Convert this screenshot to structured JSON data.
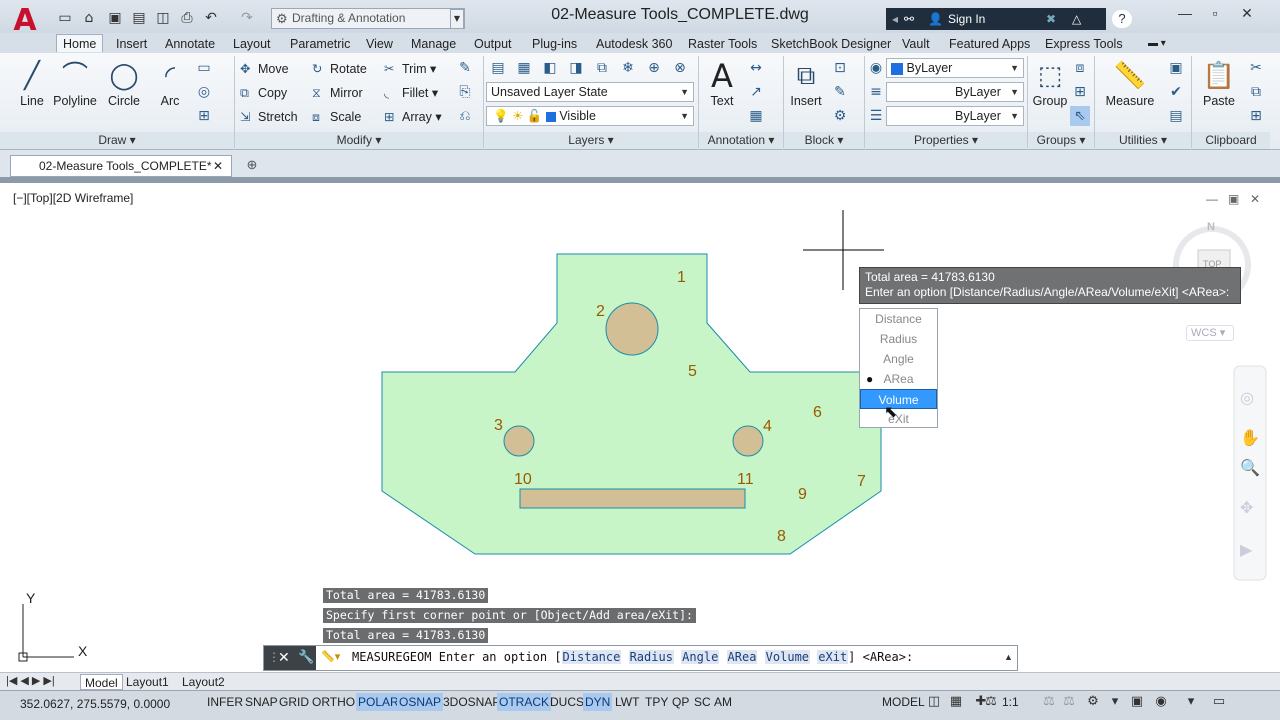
{
  "window": {
    "title": "02-Measure Tools_COMPLETE.dwg",
    "workspace": "Drafting & Annotation",
    "sign_in": "Sign In"
  },
  "ribbon_tabs": [
    "Home",
    "Insert",
    "Annotate",
    "Layout",
    "Parametric",
    "View",
    "Manage",
    "Output",
    "Plug-ins",
    "Autodesk 360",
    "Raster Tools",
    "SketchBook Designer",
    "Vault",
    "Featured Apps",
    "Express Tools"
  ],
  "draw": {
    "title": "Draw",
    "line": "Line",
    "polyline": "Polyline",
    "circle": "Circle",
    "arc": "Arc"
  },
  "modify": {
    "title": "Modify",
    "move": "Move",
    "rotate": "Rotate",
    "trim": "Trim",
    "copy": "Copy",
    "mirror": "Mirror",
    "fillet": "Fillet",
    "stretch": "Stretch",
    "scale": "Scale",
    "array": "Array"
  },
  "layers": {
    "title": "Layers",
    "layer_state": "Unsaved Layer State",
    "layer_vis": "Visible"
  },
  "annotation": {
    "title": "Annotation",
    "text": "Text"
  },
  "block": {
    "title": "Block",
    "insert": "Insert"
  },
  "properties": {
    "title": "Properties",
    "color": "ByLayer",
    "linetype": "ByLayer",
    "lineweight": "ByLayer"
  },
  "groups": {
    "title": "Groups",
    "group": "Group"
  },
  "utilities": {
    "title": "Utilities",
    "measure": "Measure"
  },
  "clipboard": {
    "title": "Clipboard",
    "paste": "Paste"
  },
  "file_tab": "02-Measure Tools_COMPLETE*",
  "viewport_label": "[−][Top][2D Wireframe]",
  "viewcube": {
    "top": "TOP",
    "north": "N",
    "wcs": "WCS"
  },
  "tooltip": {
    "line1": "Total area = 41783.6130",
    "line2": "Enter an option [Distance/Radius/Angle/ARea/Volume/eXit] <ARea>:"
  },
  "options_menu": [
    "Distance",
    "Radius",
    "Angle",
    "ARea",
    "Volume",
    "eXit"
  ],
  "drawing_labels": [
    "1",
    "2",
    "3",
    "4",
    "5",
    "6",
    "7",
    "8",
    "9",
    "10",
    "11"
  ],
  "history": [
    "Total area = 41783.6130",
    "Specify first corner point or [Object/Add area/eXit]:",
    "Total area = 41783.6130"
  ],
  "command": {
    "name": "MEASUREGEOM",
    "prompt": "Enter an option [",
    "keywords": [
      "Distance",
      "Radius",
      "Angle",
      "ARea",
      "Volume",
      "eXit"
    ],
    "suffix": "] <ARea>:"
  },
  "layout_tabs": [
    "Model",
    "Layout1",
    "Layout2"
  ],
  "status": {
    "coords": "352.0627, 275.5579, 0.0000",
    "buttons": [
      "INFER",
      "SNAP",
      "GRID",
      "ORTHO",
      "POLAR",
      "OSNAP",
      "3DOSNAP",
      "OTRACK",
      "DUCS",
      "DYN",
      "LWT",
      "TPY",
      "QP",
      "SC",
      "AM"
    ],
    "model": "MODEL",
    "scale": "1:1"
  },
  "ucs": {
    "x": "X",
    "y": "Y"
  },
  "colors": {
    "region_fill": "#c8f5c8",
    "hole_fill": "#d2bf96",
    "label_color": "#9a5a00",
    "selected_option": "#3399ff"
  }
}
